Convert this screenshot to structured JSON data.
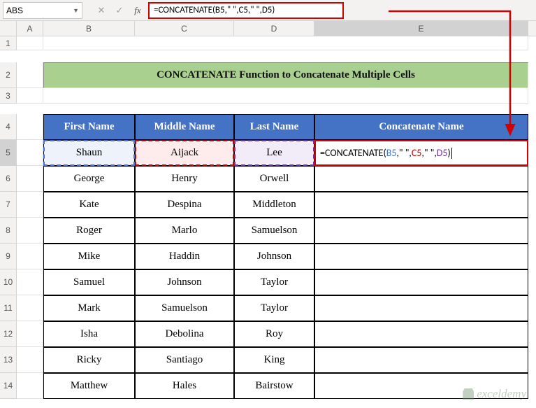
{
  "name_box": "ABS",
  "formula_bar": "=CONCATENATE(B5,\" \",C5,\" \",D5)",
  "columns": [
    "",
    "A",
    "B",
    "C",
    "D",
    "E"
  ],
  "title": "CONCATENATE Function to Concatenate Multiple Cells",
  "headers": {
    "first": "First Name",
    "middle": "Middle Name",
    "last": "Last Name",
    "concat": "Concatenate Name"
  },
  "edit_formula": {
    "prefix": "=CONCATENATE(",
    "b": "B5",
    "sep1": ",\" \",",
    "c": "C5",
    "sep2": ",\" \",",
    "d": "D5",
    "suffix": ")"
  },
  "rows": [
    {
      "n": 5,
      "first": "Shaun",
      "middle": "Aijack",
      "last": "Lee"
    },
    {
      "n": 6,
      "first": "George",
      "middle": "Henry",
      "last": "Orwell"
    },
    {
      "n": 7,
      "first": "Kate",
      "middle": "Despina",
      "last": "Middleton"
    },
    {
      "n": 8,
      "first": "Roger",
      "middle": "Marlo",
      "last": "Samuelson"
    },
    {
      "n": 9,
      "first": "Mike",
      "middle": "Haddin",
      "last": "Johnson"
    },
    {
      "n": 10,
      "first": "Samuel",
      "middle": "Johnson",
      "last": "Taylor"
    },
    {
      "n": 11,
      "first": "Mark",
      "middle": "Samuelson",
      "last": "Taylor"
    },
    {
      "n": 12,
      "first": "Isha",
      "middle": "Debolina",
      "last": "Roy"
    },
    {
      "n": 13,
      "first": "Ricky",
      "middle": "Santiago",
      "last": "King"
    },
    {
      "n": 14,
      "first": "Matthew",
      "middle": "Hales",
      "last": "Bairstow"
    }
  ],
  "watermark": "exceldemy"
}
